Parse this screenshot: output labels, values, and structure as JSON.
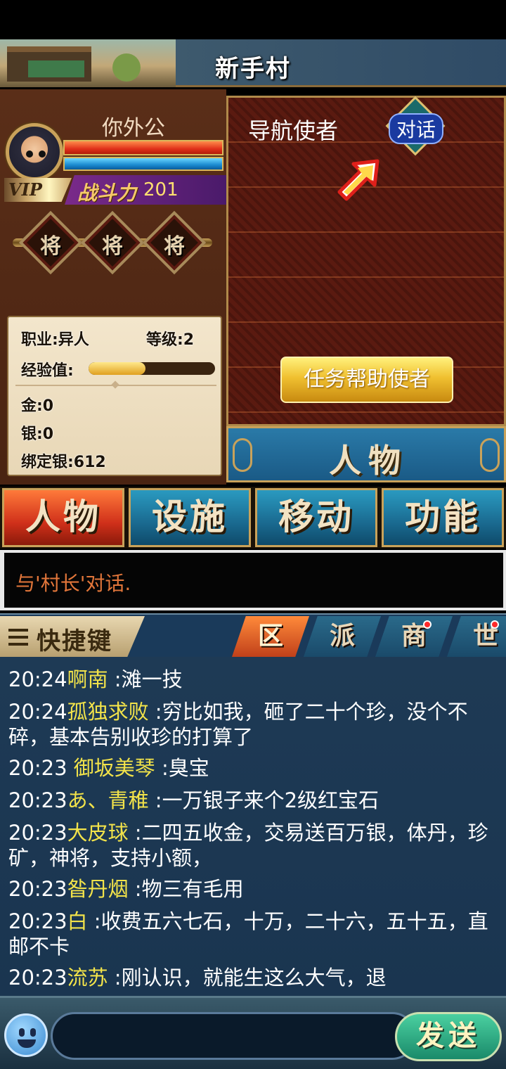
{
  "header": {
    "location": "新手村"
  },
  "player": {
    "name": "你外公",
    "vip_label": "VIP",
    "power_label": "战斗力",
    "power_value": "201",
    "generals": [
      "将",
      "将",
      "将"
    ],
    "class_text": "职业:异人",
    "level_text": "等级:2",
    "exp_label": "经验值:",
    "exp_progress": 0.45,
    "gold_text": "金:0",
    "silver_text": "银:0",
    "bound_silver_text": "绑定银:612"
  },
  "npc": {
    "name": "导航使者",
    "talk_label": "对话",
    "help_button": "任务帮助使者",
    "person_tab": "人物"
  },
  "menu": {
    "items": [
      "人物",
      "设施",
      "移动",
      "功能"
    ],
    "active_index": 0
  },
  "notice": {
    "text": "与'村长'对话."
  },
  "chat": {
    "quick_key_label": "快捷键",
    "tabs": [
      {
        "label": "区",
        "has_dot": false
      },
      {
        "label": "派",
        "has_dot": false
      },
      {
        "label": "商",
        "has_dot": true
      },
      {
        "label": "世",
        "has_dot": true
      }
    ],
    "messages": [
      {
        "time": "20:24",
        "nick": "啊南",
        "text": " :滩一技"
      },
      {
        "time": "20:24",
        "nick": "孤独求败",
        "text": " :穷比如我，砸了二十个珍，没个不碎，基本告别收珍的打算了"
      },
      {
        "time": "20:23",
        "nick": "    御坂美琴",
        "text": " :臭宝"
      },
      {
        "time": "20:23",
        "nick": "あ、青稚",
        "text": " :一万银子来个2级红宝石"
      },
      {
        "time": "20:23",
        "nick": "大皮球",
        "text": "  :二四五收金，交易送百万银，体丹，珍矿，神将，支持小额，"
      },
      {
        "time": "20:23",
        "nick": "昝丹烟",
        "text": "  :物三有毛用"
      },
      {
        "time": "20:23",
        "nick": "白",
        "text": " :收费五六七石，十万，二十六，五十五，直邮不卡"
      },
      {
        "time": "20:23",
        "nick": "流苏",
        "text": " :刚认识，就能生这么大气，退"
      }
    ],
    "send_label": "发送"
  },
  "colors": {
    "nick": "#f2e34a",
    "notice": "#e2763a",
    "power": "#ffe070"
  }
}
